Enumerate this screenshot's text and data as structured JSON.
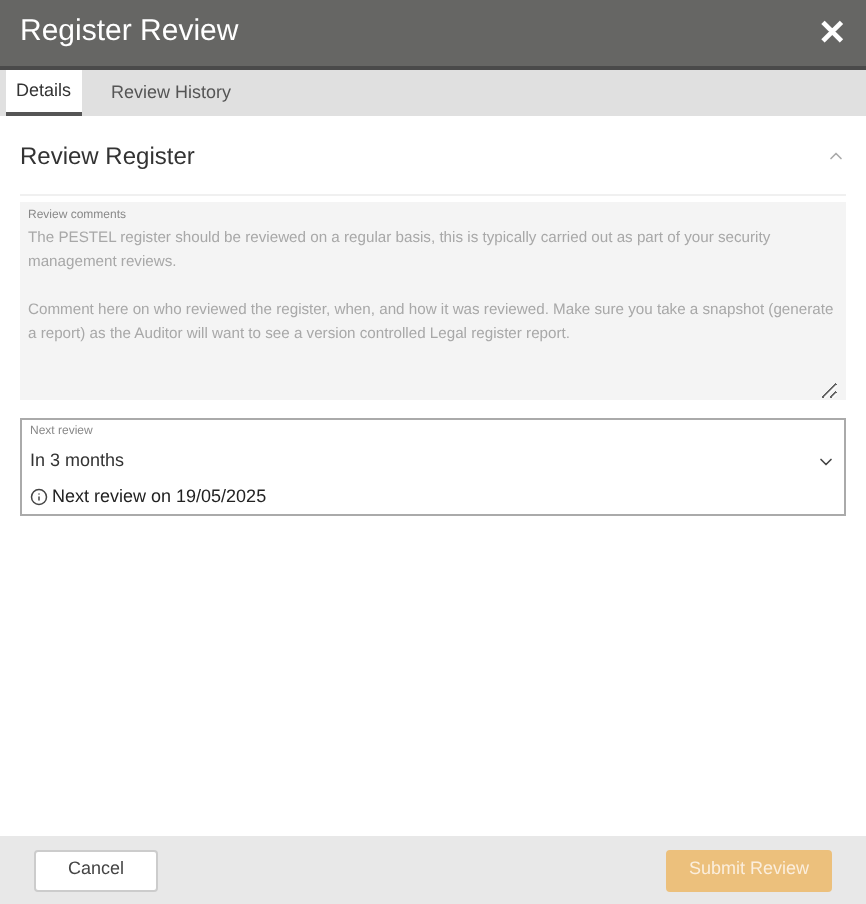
{
  "window": {
    "title": "Register Review",
    "close": "✕"
  },
  "tabs": [
    {
      "label": "Details",
      "selected": true
    },
    {
      "label": "Review History",
      "selected": false
    }
  ],
  "section": {
    "title": "Review Register",
    "expanded": true
  },
  "comments": {
    "label": "Review comments",
    "placeholder": "The PESTEL register should be reviewed on a regular basis, this is typically carried out as part of your security management reviews.\n\nComment here on who reviewed the register, when, and how it was reviewed. Make sure you take a snapshot (generate a report) as the Auditor will want to see a version controlled Legal register report."
  },
  "next_review": {
    "label": "Next review",
    "value": "In 3 months",
    "hint": "Next review on 19/05/2025"
  },
  "buttons": [
    {
      "label": "Cancel",
      "kind": "secondary",
      "disabled": false
    },
    {
      "label": "Submit Review",
      "kind": "primary",
      "disabled": true
    }
  ]
}
